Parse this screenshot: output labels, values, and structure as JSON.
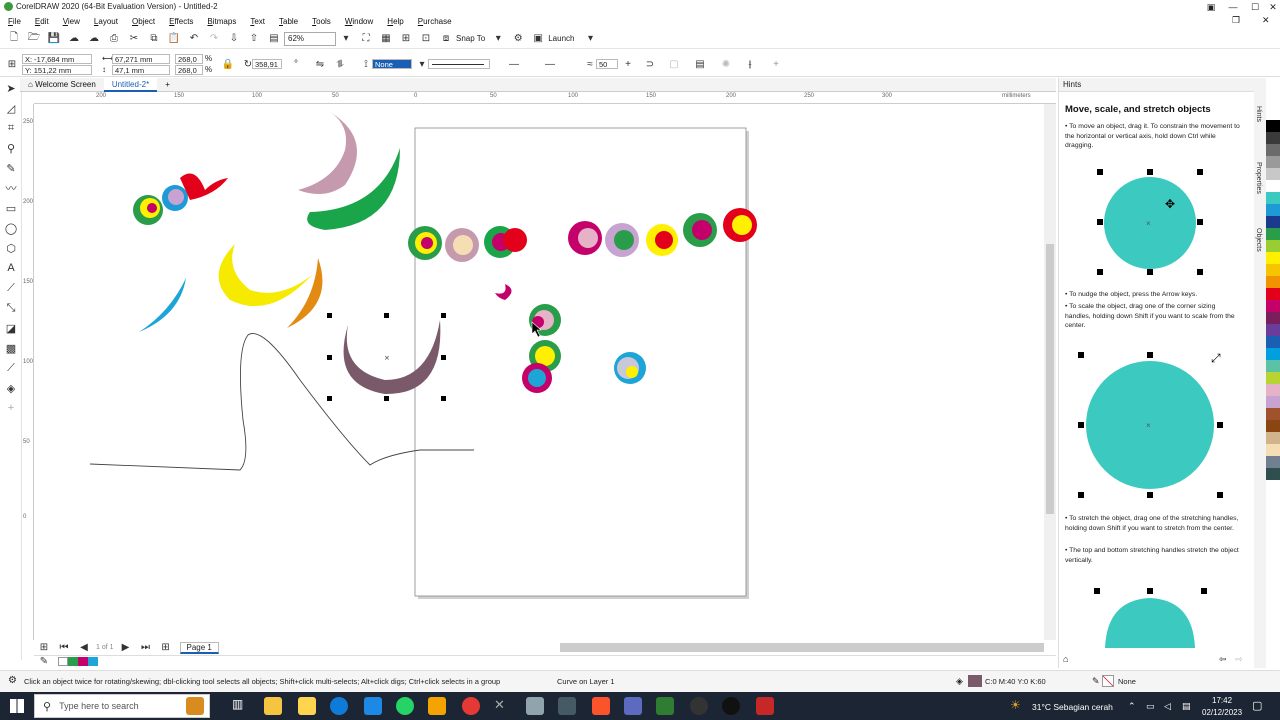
{
  "window": {
    "title": "CorelDRAW 2020 (64-Bit Evaluation Version) - Untitled-2"
  },
  "menu": [
    "File",
    "Edit",
    "View",
    "Layout",
    "Object",
    "Effects",
    "Bitmaps",
    "Text",
    "Table",
    "Tools",
    "Window",
    "Help",
    "Purchase"
  ],
  "toolbar": {
    "zoom_value": "62%",
    "snap_label": "Snap To",
    "launch_label": "Launch"
  },
  "propbar": {
    "x": "X: -17,684 mm",
    "y": "Y: 151,22 mm",
    "w": "67,271 mm",
    "h": "47,1 mm",
    "scale_w": "268,0",
    "scale_h": "268,0",
    "pct": "%",
    "angle": "358,91",
    "fill_none": "None",
    "smooth": "50"
  },
  "tabs": {
    "welcome": "Welcome Screen",
    "doc": "Untitled-2*",
    "add": "+"
  },
  "ruler": {
    "unit": "millimeters",
    "h_labels": [
      "200",
      "150",
      "100",
      "50",
      "0",
      "50",
      "100",
      "150",
      "200",
      "250",
      "300"
    ],
    "v_labels": [
      "250",
      "200",
      "150",
      "100",
      "50",
      "0"
    ]
  },
  "pagebar": {
    "pages": "1 of 1",
    "page_tab": "Page 1"
  },
  "status": {
    "hint": "Click an object twice for rotating/skewing; dbl-clicking tool selects all objects; Shift+click multi-selects; Alt+click digs; Ctrl+click selects in a group",
    "layer": "Curve on Layer 1",
    "fill_cmyk": "C:0 M:40 Y:0 K:60",
    "outline": "None"
  },
  "hints": {
    "panel_title": "Hints",
    "heading": "Move, scale, and stretch objects",
    "p1": "• To move an object, drag it. To constrain the movement to the horizontal or vertical axis, hold down Ctrl while dragging.",
    "p2": "• To nudge the object, press the Arrow keys.",
    "p3": "• To scale the object, drag one of the corner sizing handles, holding down Shift if you want to scale from the center.",
    "p4": "• To stretch the object, drag one of the stretching handles, holding down Shift if you want to stretch from the center.",
    "p5": "• The top and bottom stretching handles stretch the object vertically."
  },
  "sidetabs": [
    "Hints",
    "Properties",
    "Objects"
  ],
  "taskbar": {
    "search_placeholder": "Type here to search",
    "weather": "31°C  Sebagian cerah",
    "time": "17:42",
    "date": "02/12/2023"
  },
  "colors": {
    "accent": "#1a5fb4",
    "selected_fill": "#7a5a6a",
    "hint_circle": "#3cc9c0",
    "palette": [
      "#000000",
      "#3a3a3a",
      "#6b6b6b",
      "#9a9a9a",
      "#c8c8c8",
      "#ffffff",
      "#3cc9c0",
      "#1e9ad6",
      "#1b3a8c",
      "#2a9d4a",
      "#9acd32",
      "#ffef00",
      "#f6c400",
      "#f39200",
      "#e2001a",
      "#c4006a",
      "#7a1f5c",
      "#6a3d9a",
      "#1a5fb4",
      "#00a0e0",
      "#5bc2a6",
      "#b7d433",
      "#e5b2c8",
      "#c8a2d0",
      "#a0522d",
      "#8b4513",
      "#d2b48c",
      "#f5deb3",
      "#708090",
      "#2f4f4f"
    ]
  }
}
